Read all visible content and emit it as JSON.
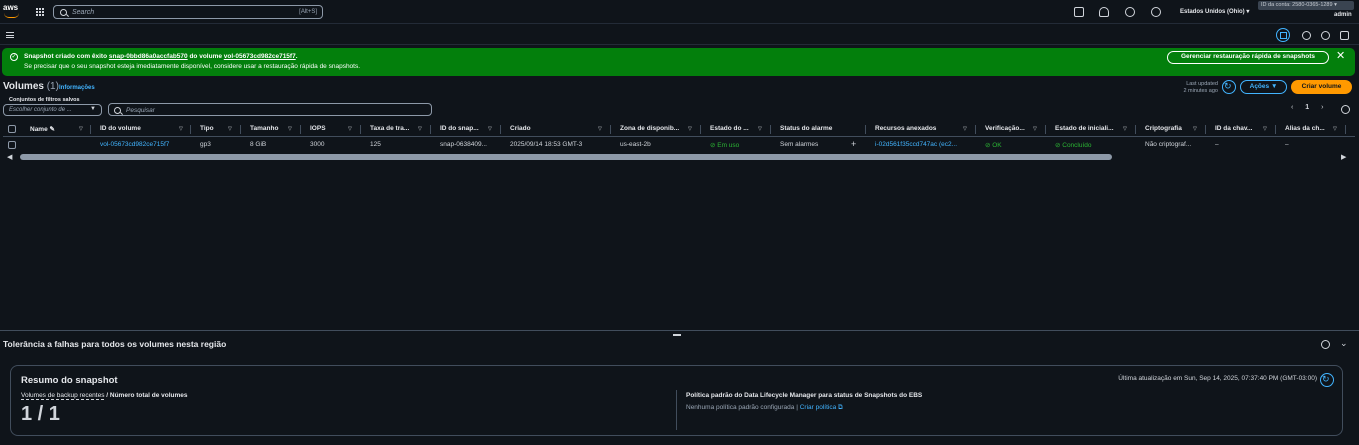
{
  "nav": {
    "logo_text": "aws",
    "search_placeholder": "Search",
    "search_shortcut": "[Alt+S]",
    "region": "Estados Unidos (Ohio) ▾",
    "account": "ID da conta: 2580-0365-1289 ▾",
    "user": "admin"
  },
  "flash": {
    "line1_prefix": "Snapshot criado com êxito ",
    "snapshot_id": "snap-0bbd86a0accfab570",
    "line1_mid": " do volume ",
    "volume_id": "vol-05673cd982ce715f7",
    "line1_end": ".",
    "line2": "Se precisar que o seu snapshot esteja imediatamente disponível, considere usar a restauração rápida de snapshots.",
    "button": "Gerenciar restauração rápida de snapshots",
    "close": "✕"
  },
  "header": {
    "title": "Volumes",
    "count": "(1)",
    "info": "Informações",
    "last_updated": "Last updated",
    "last_updated_ago": "2 minutes ago",
    "actions": "Ações ▼",
    "create": "Criar volume"
  },
  "filters": {
    "label": "Conjuntos de filtros salvos",
    "select_placeholder": "Escolher conjunto de ...",
    "search_placeholder": "Pesquisar"
  },
  "pagination": {
    "prev": "‹",
    "page": "1",
    "next": "›"
  },
  "table": {
    "columns": [
      "Name ✎",
      "ID do volume",
      "Tipo",
      "Tamanho",
      "IOPS",
      "Taxa de tra...",
      "ID do snap...",
      "Criado",
      "Zona de disponib...",
      "Estado do ...",
      "Status do alarme",
      "Recursos anexados",
      "Verificação...",
      "Estado de iniciali...",
      "Criptografia",
      "ID da chav...",
      "Alias da ch..."
    ],
    "row": {
      "volume_id": "vol-05673cd982ce715f7",
      "type": "gp3",
      "size": "8 GiB",
      "iops": "3000",
      "throughput": "125",
      "snapshot": "snap-0638409...",
      "created": "2025/09/14 18:53 GMT-3",
      "zone": "us-east-2b",
      "state": "⊘ Em uso",
      "alarm": "Sem alarmes",
      "alarm_add": "+",
      "attached": "i-02d561f35ccd747ac (ec2...",
      "check": "⊘ OK",
      "init": "⊘ Concluído",
      "encryption": "Não criptograf...",
      "key_id": "–",
      "key_alias": "–"
    }
  },
  "bottom": {
    "title": "Tolerância a falhas para todos os volumes nesta região",
    "card_title": "Resumo do snapshot",
    "updated": "Última atualização em Sun, Sep 14, 2025, 07:37:40 PM (GMT-03:00)",
    "metric_label_a": "Volumes de backup recentes",
    "metric_label_b": " / Número total de volumes",
    "metric_value": "1 / 1",
    "policy_title": "Política padrão do Data Lifecycle Manager para status de Snapshots do EBS",
    "policy_text": "Nenhuma política padrão configurada | ",
    "policy_link": "Criar política ⧉"
  }
}
